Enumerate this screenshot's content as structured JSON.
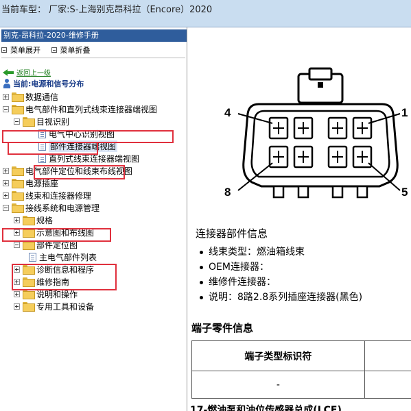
{
  "topbar": {
    "vehicle_text": "当前车型： 厂家:S-上海别克昂科拉（Encore）2020"
  },
  "sidebar": {
    "title": "别克-昂科拉-2020-维修手册",
    "menu_expand": "菜单展开",
    "menu_collapse": "菜单折叠",
    "back_link": "返回上一级",
    "current": "当前:电源和信号分布",
    "tree": [
      {
        "label": "数据通信"
      },
      {
        "label": "电气部件和直列式线束连接器端视图"
      },
      {
        "label": "目视识别"
      },
      {
        "label": "电气中心识别视图"
      },
      {
        "label": "部件连接器端视图"
      },
      {
        "label": "直列式线束连接器端视图"
      },
      {
        "label": "电气部件定位和线束布线视图"
      },
      {
        "label": "电源插座"
      },
      {
        "label": "线束和连接器修理"
      },
      {
        "label": "接线系统和电源管理"
      },
      {
        "label": "规格"
      },
      {
        "label": "示意图和布线图"
      },
      {
        "label": "部件定位图"
      },
      {
        "label": "主电气部件列表"
      },
      {
        "label": "诊断信息和程序"
      },
      {
        "label": "维修指南"
      },
      {
        "label": "说明和操作"
      },
      {
        "label": "专用工具和设备"
      }
    ]
  },
  "connector": {
    "pin_top_left": "4",
    "pin_top_right": "1",
    "pin_bottom_left": "8",
    "pin_bottom_right": "5"
  },
  "info": {
    "title": "连接器部件信息",
    "items": [
      "线束类型：燃油箱线束",
      "OEM连接器：",
      "维修件连接器：",
      "说明：8路2.8系列插座连接器(黑色)"
    ]
  },
  "terminal": {
    "title": "端子零件信息",
    "header": "端子类型标识符",
    "cell": "-"
  },
  "bottom_cut": "17-燃油泵和油位传感器总成(LCE)"
}
